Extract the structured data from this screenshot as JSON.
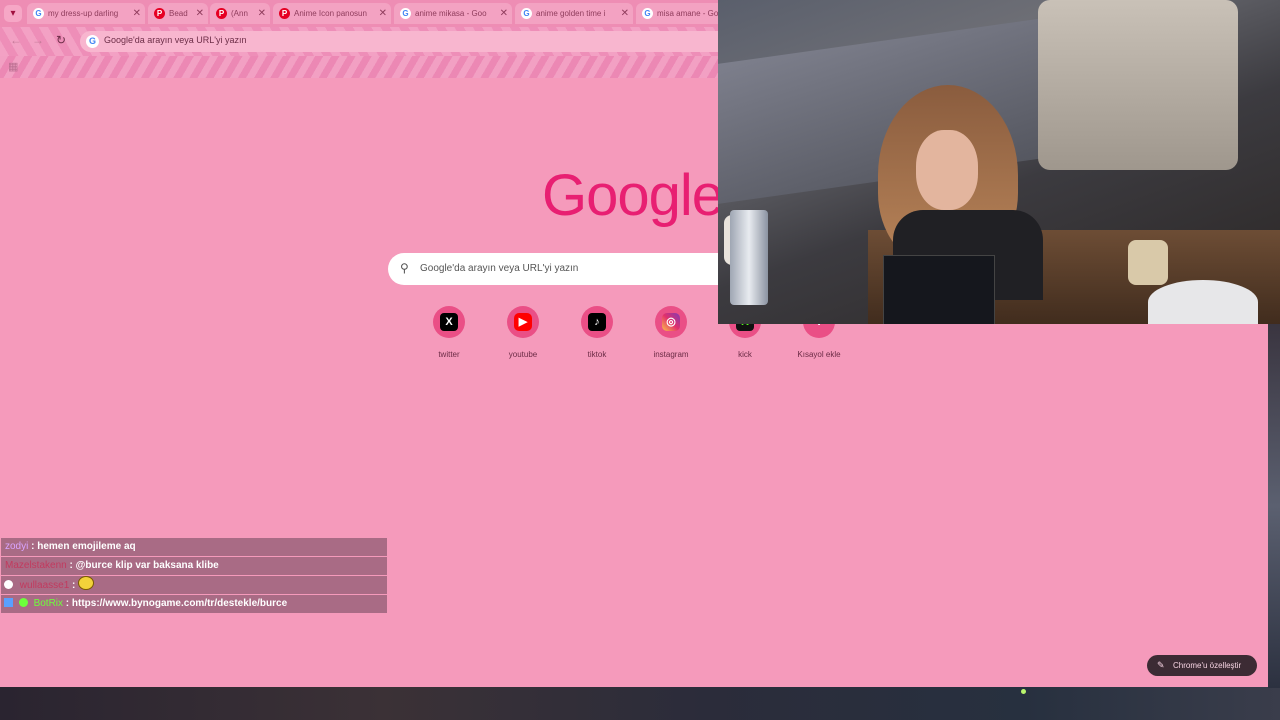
{
  "browser": {
    "tabs": [
      {
        "title": "my dress-up darling",
        "favicon": "google"
      },
      {
        "title": "Bead",
        "favicon": "pinterest"
      },
      {
        "title": "(Ann",
        "favicon": "pinterest"
      },
      {
        "title": "Anime Icon panosun",
        "favicon": "pinterest"
      },
      {
        "title": "anime mikasa - Goo",
        "favicon": "google"
      },
      {
        "title": "anime golden time i",
        "favicon": "google"
      },
      {
        "title": "misa amane - Go",
        "favicon": "google"
      }
    ],
    "omnibox_text": "Google'da arayın veya URL'yi yazın"
  },
  "ntp": {
    "logo": "Google",
    "search_placeholder": "Google'da arayın veya URL'yi yazın",
    "shortcuts": [
      {
        "label": "twitter",
        "icon": "x-logo-icon"
      },
      {
        "label": "youtube",
        "icon": "youtube-icon"
      },
      {
        "label": "tiktok",
        "icon": "tiktok-icon"
      },
      {
        "label": "instagram",
        "icon": "instagram-icon"
      },
      {
        "label": "kick",
        "icon": "kick-icon"
      },
      {
        "label": "Kısayol ekle",
        "icon": "plus-icon"
      }
    ],
    "customize_label": "Chrome'u özelleştir"
  },
  "chat": [
    {
      "user": "zodyi",
      "message": "hemen emojileme aq",
      "user_color": "#d9a4ff"
    },
    {
      "user": "Mazelstakenn",
      "message": "@burce klip var baksana klibe",
      "user_color": "#c23a5e"
    },
    {
      "user": "wullaasse1",
      "message": "",
      "user_color": "#c23a5e"
    },
    {
      "user": "BotRix",
      "message": "https://www.bynogame.com/tr/destekle/burce",
      "user_color": "#6dff3b"
    }
  ],
  "colors": {
    "page_bg": "#f59abb",
    "logo": "#e81f72",
    "shortcut_circle": "#ea4f86"
  }
}
